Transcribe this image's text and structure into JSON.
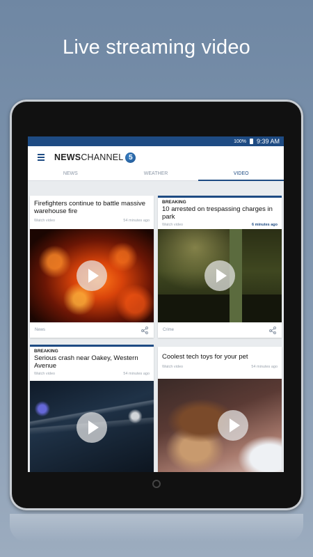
{
  "promo": {
    "headline": "Live streaming video"
  },
  "status_bar": {
    "battery": "100%",
    "time": "9:39 AM"
  },
  "app": {
    "logo_bold": "NEWS",
    "logo_regular": "CHANNEL",
    "logo_mark": "5"
  },
  "tabs": [
    {
      "label": "NEWS",
      "active": false
    },
    {
      "label": "WEATHER",
      "active": false
    },
    {
      "label": "VIDEO",
      "active": true
    }
  ],
  "cards": [
    {
      "kicker": "",
      "title": "Firefighters continue to battle massive warehouse fire",
      "watch": "Watch video",
      "age": "54 minutes ago",
      "category": "News",
      "thumb": "fire-scene"
    },
    {
      "kicker": "BREAKING",
      "title": "10 arrested on trespassing charges in park",
      "watch": "Watch video",
      "age": "6 minutes ago",
      "category": "Crime",
      "thumb": "night-arrest"
    },
    {
      "kicker": "BREAKING",
      "title": "Serious crash near Oakey, Western Avenue",
      "watch": "Watch video",
      "age": "54 minutes ago",
      "category": "",
      "thumb": "night-road"
    },
    {
      "kicker": "",
      "title": "Coolest tech toys for your pet",
      "watch": "Watch video",
      "age": "54 minutes ago",
      "category": "",
      "thumb": "beagle-dog"
    }
  ],
  "colors": {
    "brand": "#1e4b83",
    "background": "#7f95ae"
  }
}
